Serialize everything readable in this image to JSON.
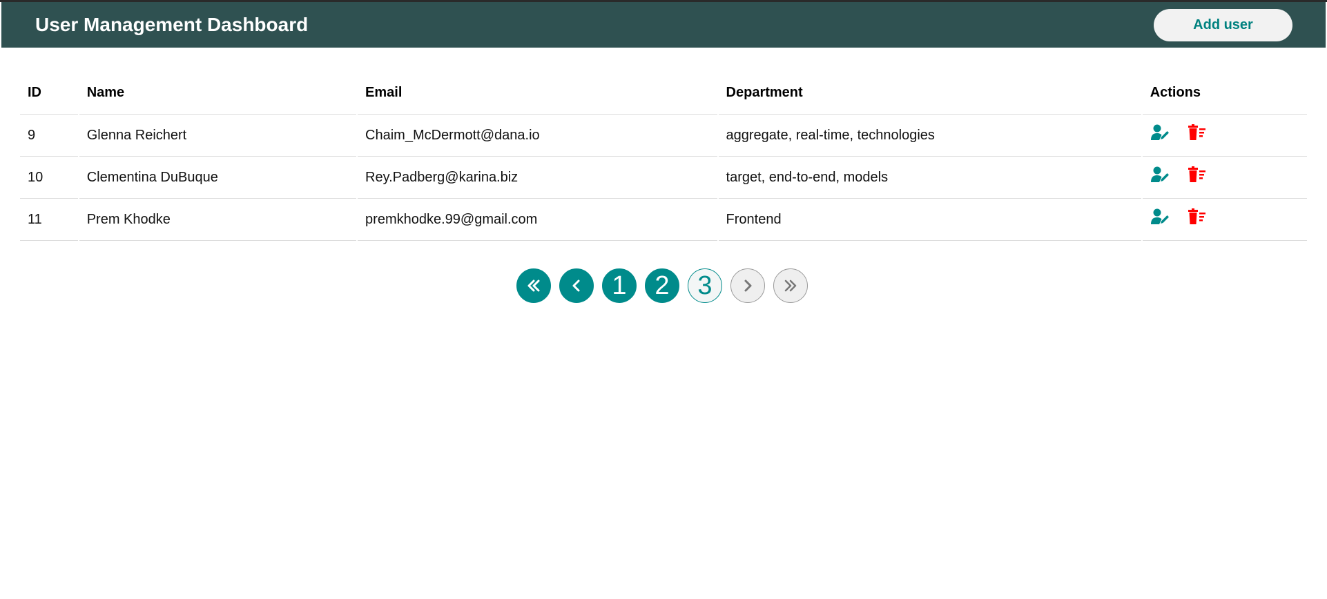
{
  "header": {
    "title": "User Management Dashboard",
    "add_user_label": "Add user"
  },
  "table": {
    "columns": [
      "ID",
      "Name",
      "Email",
      "Department",
      "Actions"
    ],
    "rows": [
      {
        "id": "9",
        "name": "Glenna Reichert",
        "email": "Chaim_McDermott@dana.io",
        "department": "aggregate, real-time, technologies"
      },
      {
        "id": "10",
        "name": "Clementina DuBuque",
        "email": "Rey.Padberg@karina.biz",
        "department": "target, end-to-end, models"
      },
      {
        "id": "11",
        "name": "Prem Khodke",
        "email": "premkhodke.99@gmail.com",
        "department": "Frontend"
      }
    ],
    "row_actions": [
      {
        "name": "edit-user-icon",
        "color": "#008b8b"
      },
      {
        "name": "delete-user-icon",
        "color": "#ff0000"
      }
    ]
  },
  "pagination": {
    "pages": [
      "1",
      "2",
      "3"
    ],
    "current_page": "3",
    "first_icon": "double-chevron-left-icon",
    "prev_icon": "chevron-left-icon",
    "next_icon": "chevron-right-icon",
    "last_icon": "double-chevron-right-icon",
    "next_disabled": true,
    "last_disabled": true
  },
  "colors": {
    "header_bg": "#2f5151",
    "accent": "#008b8b",
    "danger": "#ff0000"
  }
}
